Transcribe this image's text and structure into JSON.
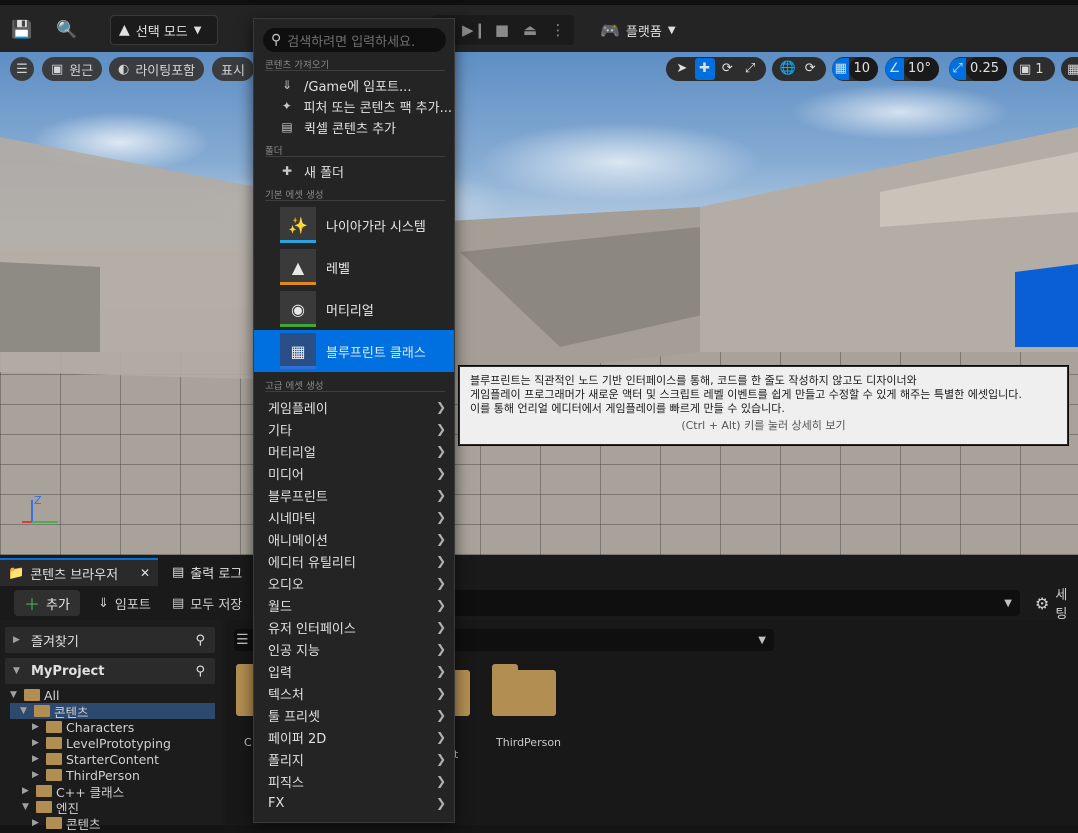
{
  "toolbar": {
    "mode_label": "선택 모드",
    "platform_label": "플랫폼"
  },
  "viewport": {
    "menu_icon": "hamburger-icon",
    "perspective_label": "원근",
    "lighting_label": "라이팅포함",
    "show_label": "표시",
    "grid_snap_value": "10",
    "rotation_snap_value": "10°",
    "scale_snap_value": "0.25",
    "camera_speed_value": "1",
    "axis_z": "Z"
  },
  "menu": {
    "search_placeholder": "검색하려면 입력하세요.",
    "section_get_content": "콘텐츠 가져오기",
    "import_label": "/Game에 임포트...",
    "feature_pack_label": "피처 또는 콘텐츠 팩 추가...",
    "quixel_label": "퀵셀 콘텐츠 추가",
    "section_folder": "폴더",
    "new_folder_label": "새 폴더",
    "section_basic_assets": "기본 에셋 생성",
    "basic_assets": [
      {
        "label": "나이아가라 시스템",
        "color": "#29a3e0",
        "icon": "niagara-icon"
      },
      {
        "label": "레벨",
        "color": "#e08a1e",
        "icon": "level-icon"
      },
      {
        "label": "머티리얼",
        "color": "#3fa835",
        "icon": "material-icon"
      },
      {
        "label": "블루프린트 클래스",
        "color": "#2f6fd6",
        "icon": "blueprint-icon"
      }
    ],
    "section_advanced_assets": "고급 에셋 생성",
    "advanced_items": [
      "게임플레이",
      "기타",
      "머티리얼",
      "미디어",
      "블루프린트",
      "시네마틱",
      "애니메이션",
      "에디터 유틸리티",
      "오디오",
      "월드",
      "유저 인터페이스",
      "인공 지능",
      "입력",
      "텍스처",
      "툴 프리셋",
      "페이퍼 2D",
      "폴리지",
      "피직스",
      "FX"
    ]
  },
  "tooltip": {
    "line1": "블루프린트는 직관적인 노드 기반 인터페이스를 통해, 코드를 한 줄도 작성하지 않고도 디자이너와",
    "line2": "게임플레이 프로그래머가 새로운 액터 및 스크립트 레벨 이벤트를 쉽게 만들고 수정할 수 있게 해주는 특별한 에셋입니다.",
    "line3": "이를 통해 언리얼 에디터에서 게임플레이를 빠르게 만들 수 있습니다.",
    "hint": "(Ctrl + Alt) 키를 눌러 상세히 보기"
  },
  "content_browser": {
    "tab_label": "콘텐츠 브라우저",
    "output_log_label": "출력 로그",
    "add_label": "추가",
    "import_label": "임포트",
    "save_all_label": "모두 저장",
    "settings_label": "세팅",
    "favorites_label": "즐겨찾기",
    "project_label": "MyProject",
    "tree": {
      "all": "All",
      "content": "콘텐츠",
      "characters": "Characters",
      "level_prototyping": "LevelPrototyping",
      "starter_content": "StarterContent",
      "third_person": "ThirdPerson",
      "cpp_classes": "C++ 클래스",
      "engine": "엔진",
      "engine_content": "콘텐츠"
    },
    "folders": [
      {
        "label": "C"
      },
      {
        "label": "t"
      },
      {
        "label": "ThirdPerson"
      }
    ]
  }
}
